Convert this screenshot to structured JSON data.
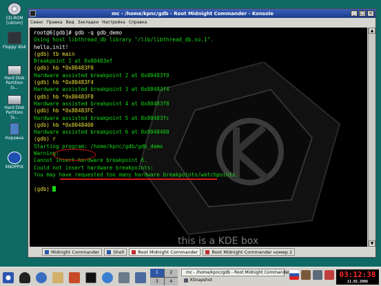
{
  "desktop_icons": [
    {
      "label": "CD-ROM\n[cdrom]",
      "icon": "cdrom-icon"
    },
    {
      "label": "Floppy disk",
      "icon": "floppy-icon"
    },
    {
      "label": "Hard Disk\nPartition [s...",
      "icon": "hard-disk-icon"
    },
    {
      "label": "Hard Disk\nPartition [s...",
      "icon": "hard-disk-icon"
    },
    {
      "label": "Корзина",
      "icon": "trash-icon"
    },
    {
      "label": "KNOPPIX",
      "icon": "knoppix-icon"
    }
  ],
  "window": {
    "title": "mc - /home/kpnc/gdb - Root Midnight Commander - Konsole",
    "controls": {
      "minimize": "_",
      "maximize": "□",
      "close": "×"
    }
  },
  "menubar": [
    "Сеанс",
    "Правка",
    "Вид",
    "Закладки",
    "Настройка",
    "Справка"
  ],
  "terminal": {
    "lines": [
      {
        "text": "root@6[gdb]# gdb -q gdb_demo",
        "color": "white"
      },
      {
        "text": "Using host libthread_db library \"/lib/libthread_db.so.1\".",
        "color": "green"
      },
      {
        "text": "hello,init!",
        "color": "white"
      },
      {
        "text": "(gdb) tb main",
        "color": "yellow"
      },
      {
        "text": "Breakpoint 1 at 0x80483ef",
        "color": "green"
      },
      {
        "text": "(gdb) hb *0x80483F0",
        "color": "yellow"
      },
      {
        "text": "Hardware assisted breakpoint 2 at 0x80483f0",
        "color": "green"
      },
      {
        "text": "(gdb) hb *0x80483F4",
        "color": "yellow"
      },
      {
        "text": "Hardware assisted breakpoint 3 at 0x80483f4",
        "color": "green"
      },
      {
        "text": "(gdb) hb *0x80483F8",
        "color": "yellow"
      },
      {
        "text": "Hardware assisted breakpoint 4 at 0x80483f8",
        "color": "green"
      },
      {
        "text": "(gdb) hb *0x80483FC",
        "color": "yellow"
      },
      {
        "text": "Hardware assisted breakpoint 5 at 0x80483fc",
        "color": "green"
      },
      {
        "text": "(gdb) hb *0x8048400",
        "color": "yellow"
      },
      {
        "text": "Hardware assisted breakpoint 6 at 0x8048400",
        "color": "green"
      },
      {
        "text": "(gdb) r",
        "color": "yellow"
      },
      {
        "text": "Starting program: /home/kpnc/gdb/gdb_demo",
        "color": "green"
      },
      {
        "text": "Warning:",
        "color": "green"
      },
      {
        "text": "Cannot insert hardware breakpoint 6.",
        "color": "green"
      },
      {
        "text": "Could not insert hardware breakpoints:",
        "color": "green"
      },
      {
        "text": "You may have requested too many hardware breakpoints/watchpoints.",
        "color": "green"
      },
      {
        "text": "",
        "color": "green"
      },
      {
        "text": "(gdb) ",
        "color": "yellow",
        "cursor": true
      }
    ],
    "background_watermark": "this is a KDE box"
  },
  "tabs": [
    {
      "label": "Midnight Commander",
      "active": false
    },
    {
      "label": "Shell",
      "active": false
    },
    {
      "label": "Root Midnight Commander",
      "active": true
    },
    {
      "label": "Root Midnight Commander номер 2",
      "active": false
    }
  ],
  "taskbar": {
    "pager": [
      "1",
      "2",
      "3",
      "4"
    ],
    "active_desktop": "1",
    "tasks": [
      {
        "label": "mc - /home/kpnc/gdb - Root Midnight Commander - ...",
        "active": true
      },
      {
        "label": "KSnapshot",
        "active": false
      }
    ],
    "clock": "03:12:38",
    "date": "11.02.2006"
  },
  "colors": {
    "desktop": "#0f6a66",
    "terminal_bg": "#000000",
    "terminal_green": "#16d916",
    "terminal_yellow": "#e8e038",
    "highlight_red": "#d81818",
    "titlebar": "#2a4da3"
  }
}
